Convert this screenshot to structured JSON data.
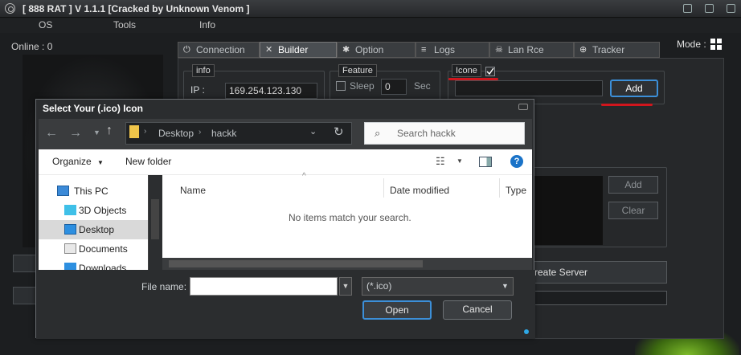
{
  "app": {
    "title": "[ 888 RAT ] V 1.1.1 [Cracked by Unknown Venom ]",
    "menu": [
      "OS",
      "Tools",
      "Info"
    ],
    "online_label": "Online : 0",
    "mode_label": "Mode :"
  },
  "tabs": [
    {
      "label": "Connection",
      "icon": "plug-icon"
    },
    {
      "label": "Builder",
      "icon": "tools-icon"
    },
    {
      "label": "Option",
      "icon": "gear-icon"
    },
    {
      "label": "Logs",
      "icon": "database-icon"
    },
    {
      "label": "Lan Rce",
      "icon": "skull-icon"
    },
    {
      "label": "Tracker",
      "icon": "globe-icon"
    }
  ],
  "builder": {
    "info_legend": "info",
    "ip_label": "IP :",
    "ip_value": "169.254.123.130",
    "feature_legend": "Feature",
    "sleep_label": "Sleep",
    "sleep_value": "0",
    "sec_label": "Sec",
    "icone_legend": "Icone",
    "icon_add": "Add",
    "list_add": "Add",
    "list_clear": "Clear",
    "create_server": "reate Server"
  },
  "dialog": {
    "title": "Select Your (.ico) Icon",
    "breadcrumb": [
      "Desktop",
      "hackk"
    ],
    "search_placeholder": "Search hackk",
    "organize": "Organize",
    "new_folder": "New folder",
    "columns": [
      "Name",
      "Date modified",
      "Type"
    ],
    "empty_message": "No items match your search.",
    "tree": [
      "This PC",
      "3D Objects",
      "Desktop",
      "Documents",
      "Downloads"
    ],
    "file_name_label": "File name:",
    "file_name_value": "",
    "filter_value": "(*.ico)",
    "open": "Open",
    "cancel": "Cancel"
  },
  "colors": {
    "accent_blue": "#3c8fd8",
    "highlight_red": "#d0161d",
    "selected_row": "#cce4f7"
  }
}
